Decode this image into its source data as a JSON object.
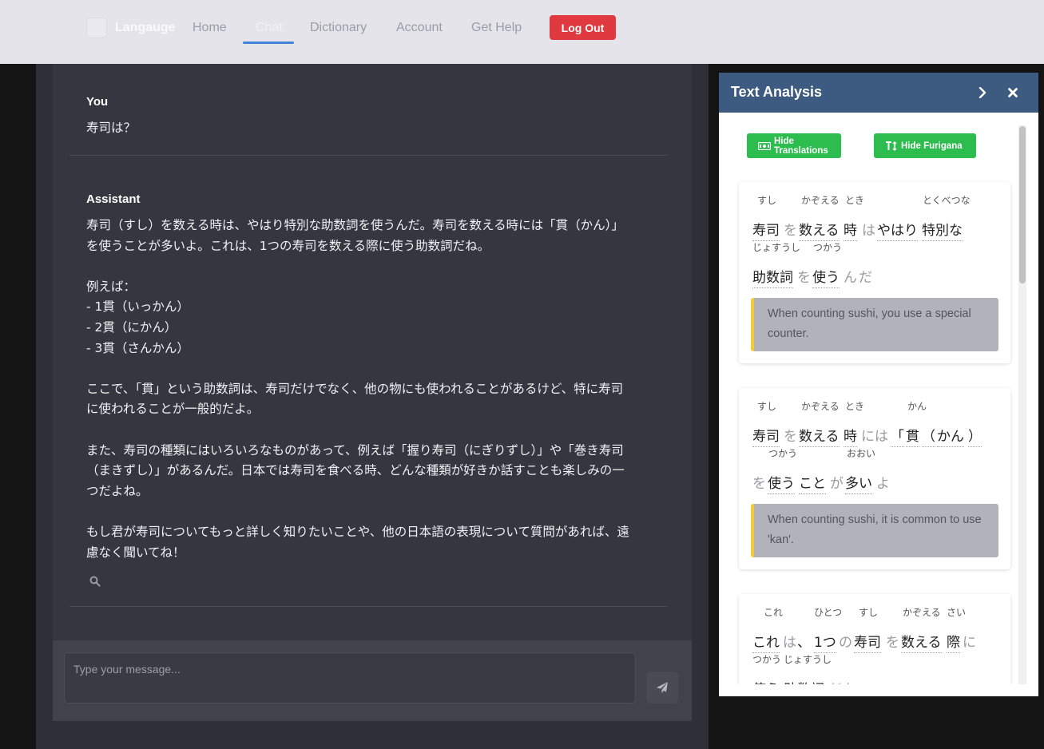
{
  "nav": {
    "brand": "Langauge",
    "links": [
      "Home",
      "Chat",
      "Dictionary",
      "Account",
      "Get Help"
    ],
    "active": "Chat",
    "logout": "Log Out"
  },
  "chat": {
    "messages": [
      {
        "role": "You",
        "text": "寿司は？"
      },
      {
        "role": "Assistant",
        "text": "寿司（すし）を数える時は、やはり特別な助数詞を使うんだ。寿司を数える時には「貫（かん）」\nを使うことが多いよ。これは、1つの寿司を数える際に使う助数詞だね。\n\n例えば：\n- 1貫（いっかん）\n- 2貫（にかん）\n- 3貫（さんかん）\n\nここで、「貫」という助数詞は、寿司だけでなく、他の物にも使われることがあるけど、特に寿司\nに使われることが一般的だよ。\n\nまた、寿司の種類にはいろいろなものがあって、例えば「握り寿司（にぎりずし）」や「巻き寿司\n（まきずし）」があるんだ。日本では寿司を食べる時、どんな種類が好きか話すことも楽しみの一\nつだよね。\n\nもし君が寿司についてもっと詳しく知りたいことや、他の日本語の表現について質問があれば、遠\n慮なく聞いてね！"
      }
    ],
    "input_placeholder": "Type your message..."
  },
  "analysis": {
    "title": "Text Analysis",
    "hide_translations": "Hide Translations",
    "hide_furigana": "Hide Furigana",
    "cards": [
      {
        "line1": {
          "furigana": [
            "すし",
            "かぞえる",
            "とき",
            "とくべつな"
          ],
          "tokens": [
            "寿司",
            "を",
            "数える",
            "時",
            "は",
            "やはり",
            "特別な"
          ]
        },
        "line2": {
          "furigana": [
            "じょすうし",
            "つかう"
          ],
          "tokens": [
            "助数詞",
            "を",
            "使う",
            "ん",
            "だ"
          ]
        },
        "translation": "When counting sushi, you use a special counter."
      },
      {
        "line1": {
          "furigana": [
            "すし",
            "かぞえる",
            "とき",
            "かん"
          ],
          "tokens": [
            "寿司",
            "を",
            "数える",
            "時",
            "には",
            "「",
            "貫",
            "（",
            "かん",
            "）"
          ]
        },
        "line2": {
          "furigana": [
            "つかう",
            "おおい"
          ],
          "tokens": [
            "を",
            "使う",
            "こと",
            "が",
            "多い",
            "よ"
          ]
        },
        "translation": "When counting sushi, it is common to use 'kan'."
      },
      {
        "line1": {
          "furigana": [
            "これ",
            "ひとつ",
            "すし",
            "かぞえる",
            "さい"
          ],
          "tokens": [
            "これ",
            "は",
            "、",
            "1つ",
            "の",
            "寿司",
            "を",
            "数える",
            "際",
            "に"
          ]
        },
        "line2": {
          "furigana": [
            "つかう",
            "じょすうし"
          ],
          "tokens": [
            "使う",
            "助数詞",
            "だ",
            "ね"
          ]
        }
      }
    ]
  },
  "colors": {
    "accent": "#3f86d8",
    "logout": "#e0393f",
    "panel_header": "#3d5a80",
    "green": "#2dbc4e",
    "highlight": "#f2cd36"
  },
  "icons": [
    "logo-icon",
    "search-icon",
    "send-icon",
    "chevron-right-icon",
    "close-icon",
    "money-icon",
    "text-height-icon"
  ]
}
